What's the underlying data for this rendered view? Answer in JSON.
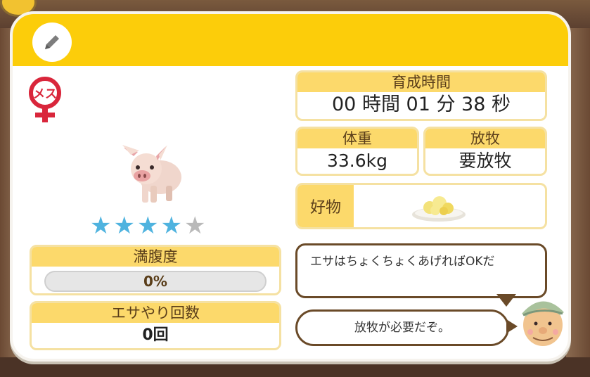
{
  "profile": {
    "gender_label": "メス",
    "stars": {
      "filled": 4,
      "total": 5
    },
    "fullness": {
      "label": "満腹度",
      "value": "0%",
      "fraction": 0.0
    },
    "feed_count": {
      "label": "エサやり回数",
      "value": "0回"
    }
  },
  "stats": {
    "growth_time": {
      "label": "育成時間",
      "value": "00 時間 01 分 38 秒"
    },
    "weight": {
      "label": "体重",
      "value": "33.6kg"
    },
    "grazing": {
      "label": "放牧",
      "value": "要放牧"
    },
    "favorite": {
      "label": "好物"
    }
  },
  "dialogue": {
    "tip": "エサはちょくちょくあげればOKだ",
    "notice": "放牧が必要だぞ。"
  },
  "icons": [
    "edit-pencil-icon",
    "female-gender-icon",
    "pig-image",
    "star-icon",
    "corn-food-icon",
    "farmer-avatar"
  ],
  "colors": {
    "header": "#fccd0a",
    "label_bg": "#fcd96b",
    "star_on": "#4fb3df",
    "star_off": "#b9b9b9",
    "female_red": "#d9263b"
  }
}
